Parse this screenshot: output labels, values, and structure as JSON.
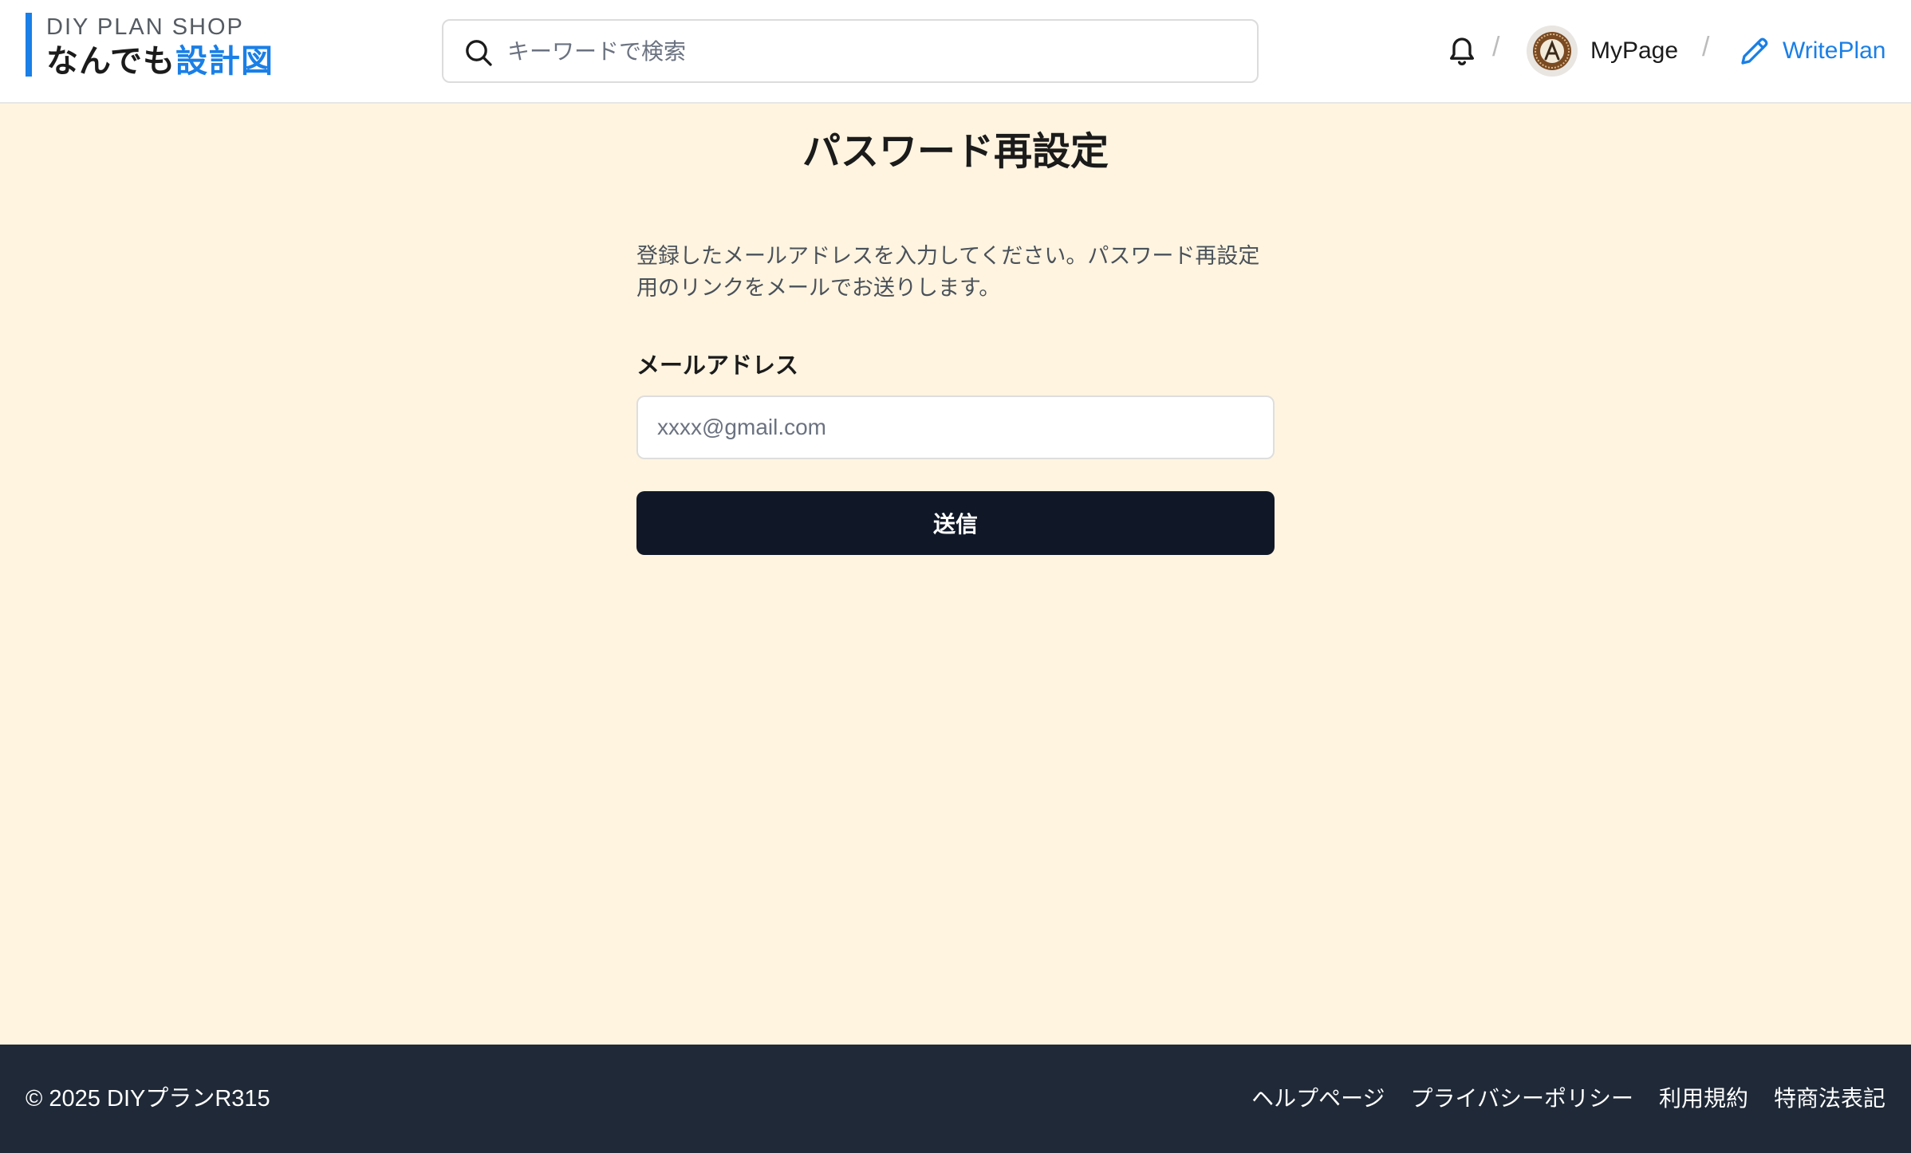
{
  "header": {
    "logo_top": "DIY PLAN SHOP",
    "logo_title_part1": "なんでも",
    "logo_title_part2": "設計図",
    "search_placeholder": "キーワードで検索",
    "separator": "/",
    "mypage_label": "MyPage",
    "writeplan_label": "WritePlan",
    "icons": {
      "search": "search-icon",
      "bell": "bell-icon",
      "avatar": "avatar",
      "pencil": "pencil-icon"
    }
  },
  "main": {
    "title": "パスワード再設定",
    "description": "登録したメールアドレスを入力してください。パスワード再設定用のリンクをメールでお送りします。",
    "email_label": "メールアドレス",
    "email_placeholder": "xxxx@gmail.com",
    "submit_label": "送信"
  },
  "footer": {
    "copyright": "© 2025 DIYプランR315",
    "links": [
      "ヘルプページ",
      "プライバシーポリシー",
      "利用規約",
      "特商法表記"
    ]
  },
  "colors": {
    "accent": "#1a7fe6",
    "page_background": "#fff4e0",
    "button": "#101828",
    "footer": "#1f2937"
  }
}
